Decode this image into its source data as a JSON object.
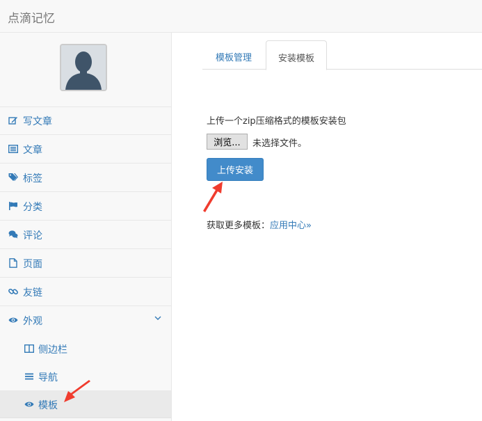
{
  "app": {
    "title": "点滴记忆"
  },
  "sidebar": {
    "items": [
      {
        "label": "写文章",
        "icon": "edit-icon"
      },
      {
        "label": "文章",
        "icon": "list-icon"
      },
      {
        "label": "标签",
        "icon": "tags-icon"
      },
      {
        "label": "分类",
        "icon": "flag-icon"
      },
      {
        "label": "评论",
        "icon": "comments-icon"
      },
      {
        "label": "页面",
        "icon": "file-icon"
      },
      {
        "label": "友链",
        "icon": "link-icon"
      },
      {
        "label": "外观",
        "icon": "eye-icon",
        "expanded": true
      }
    ],
    "subitems": [
      {
        "label": "侧边栏",
        "icon": "columns-icon"
      },
      {
        "label": "导航",
        "icon": "bars-icon"
      },
      {
        "label": "模板",
        "icon": "eye-icon",
        "active": true
      }
    ]
  },
  "tabs": [
    {
      "label": "模板管理",
      "active": false
    },
    {
      "label": "安装模板",
      "active": true
    }
  ],
  "upload": {
    "label": "上传一个zip压缩格式的模板安装包",
    "browse_label": "浏览...",
    "no_file_text": "未选择文件。",
    "install_label": "上传安装"
  },
  "more": {
    "prefix": "获取更多模板：",
    "link_text": "应用中心»"
  },
  "colors": {
    "link": "#337ab7",
    "primary_button": "#428bca",
    "annotation_arrow": "#f03c2e"
  }
}
